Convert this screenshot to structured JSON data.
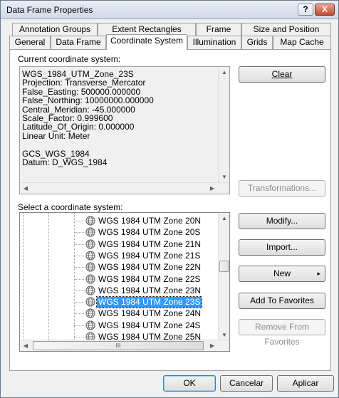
{
  "window": {
    "title": "Data Frame Properties",
    "help_label": "?",
    "close_label": "X"
  },
  "tabs_row1": [
    "Annotation Groups",
    "Extent Rectangles",
    "Frame",
    "Size and Position"
  ],
  "tabs_row2": [
    "General",
    "Data Frame",
    "Coordinate System",
    "Illumination",
    "Grids",
    "Map Cache"
  ],
  "active_tab": "Coordinate System",
  "current": {
    "label": "Current coordinate system:",
    "lines": [
      "WGS_1984_UTM_Zone_23S",
      "Projection: Transverse_Mercator",
      "False_Easting: 500000.000000",
      "False_Northing: 10000000.000000",
      "Central_Meridian: -45.000000",
      "Scale_Factor: 0.999600",
      "Latitude_Of_Origin: 0.000000",
      "Linear Unit: Meter",
      "",
      "GCS_WGS_1984",
      "Datum: D_WGS_1984"
    ]
  },
  "buttons": {
    "clear": "Clear",
    "transformations": "Transformations...",
    "modify": "Modify...",
    "import": "Import...",
    "new": "New",
    "add_favorites": "Add To Favorites",
    "remove_favorites": "Remove From Favorites"
  },
  "select": {
    "label": "Select a coordinate system:",
    "items": [
      "WGS 1984 UTM Zone 20N",
      "WGS 1984 UTM Zone 20S",
      "WGS 1984 UTM Zone 21N",
      "WGS 1984 UTM Zone 21S",
      "WGS 1984 UTM Zone 22N",
      "WGS 1984 UTM Zone 22S",
      "WGS 1984 UTM Zone 23N",
      "WGS 1984 UTM Zone 23S",
      "WGS 1984 UTM Zone 24N",
      "WGS 1984 UTM Zone 24S",
      "WGS 1984 UTM Zone 25N"
    ],
    "selected_index": 7,
    "hscroll_grip": "III"
  },
  "footer": {
    "ok": "OK",
    "cancel": "Cancelar",
    "apply": "Aplicar"
  },
  "colors": {
    "selection": "#3399ff",
    "globe": "#6e6e6e"
  },
  "icons": {
    "dropdown": "▸",
    "arrow_up": "▲",
    "arrow_down": "▼",
    "arrow_left": "◀",
    "arrow_right": "▶"
  }
}
